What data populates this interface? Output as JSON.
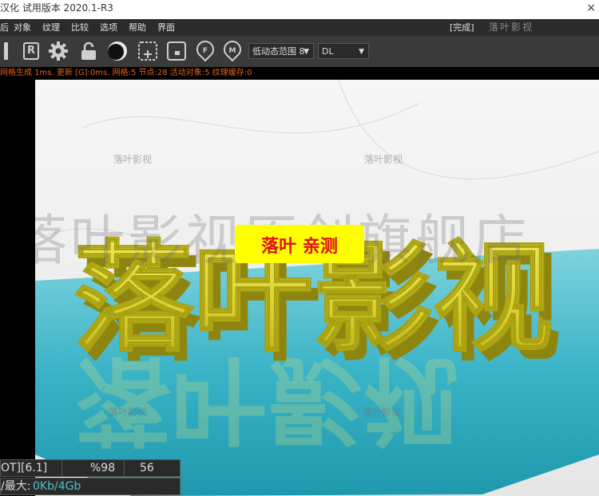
{
  "window": {
    "title": "汉化 试用版本 2020.1-R3",
    "close_glyph": "×"
  },
  "menu": {
    "items": [
      "后",
      "对象",
      "纹理",
      "比较",
      "选项",
      "帮助",
      "界面"
    ],
    "status": "[完成]",
    "watermark_top": "落叶影视"
  },
  "toolbar": {
    "icons": [
      "pause-bar-icon",
      "r-badge-icon",
      "gear-icon",
      "lock-open-icon",
      "sphere-icon",
      "add-region-icon",
      "region-icon",
      "f-pin-icon",
      "m-pin-icon"
    ],
    "r_letter": "R",
    "f_letter": "F",
    "m_letter": "M",
    "dynamic_range_select": "低动态范围 8",
    "dl_select": "DL"
  },
  "status_line": "网格生成 1ms. 更新 [G]:0ms. 网格:5 节点:28 活动对象:5 纹理缓存:0",
  "viewport": {
    "main_title": "落叶影视",
    "badge_text": "落叶 亲测",
    "watermark_line": "落叶影视原创旗舰店",
    "small_marks": [
      "落叶影视",
      "落叶影视",
      "落叶影视",
      "落叶影视"
    ],
    "colors": {
      "letter": "#d8cf2e",
      "letter_shadow": "#a89f10",
      "water": "#39b3c6",
      "badge_bg": "#ffff00",
      "badge_text": "#e0101a"
    }
  },
  "hud": {
    "ot_label": "OT][6.1]",
    "percent": "%98",
    "value": "56",
    "memory_label": "/最大:",
    "memory_value": "0Kb/4Gb"
  }
}
